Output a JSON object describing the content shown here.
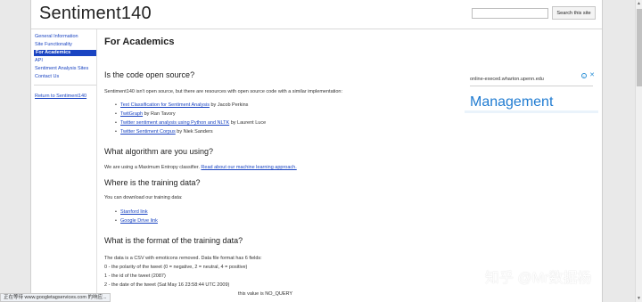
{
  "header": {
    "site_title": "Sentiment140",
    "search_button": "Search this site"
  },
  "sidebar": {
    "items": [
      {
        "label": "General Information"
      },
      {
        "label": "Site Functionality"
      },
      {
        "label": "For Academics"
      },
      {
        "label": "API"
      },
      {
        "label": "Sentiment Analysis Sites"
      },
      {
        "label": "Contact Us"
      }
    ],
    "return_link": "Return to Sentiment140"
  },
  "content": {
    "page_title": "For Academics",
    "q1": {
      "heading": "Is the code open source?",
      "text": "Sentiment140 isn't open source, but there are resources with open source code with a similar implementation:",
      "items": [
        {
          "link": "Text Classification for Sentiment Analysis",
          "suffix": " by Jacob Perkins"
        },
        {
          "link": "TwitGraph",
          "suffix": " by Ran Tavory"
        },
        {
          "link": "Twitter sentiment analysis using Python and NLTK",
          "suffix": " by Laurent Luce"
        },
        {
          "link": "Twitter Sentiment Corpus",
          "suffix": " by Niek Sanders"
        }
      ]
    },
    "q2": {
      "heading": "What algorithm are you using?",
      "text": "We are using a Maximum Entropy classifier.",
      "link": "Read about our machine learning approach."
    },
    "q3": {
      "heading": "Where is the training data?",
      "text": "You can download our training data:",
      "items": [
        "Stanford link",
        "Google Drive link"
      ]
    },
    "q4": {
      "heading": "What is the format of the training data?",
      "lines": [
        "The data is a CSV with emoticons removed. Data file format has 6 fields:",
        "0 - the polarity of the tweet (0 = negative, 2 = neutral, 4 = positive)",
        "1 - the id of the tweet (2087)",
        "2 - the date of the tweet (Sat May 16 23:58:44 UTC 2009)",
        "this value is NO_QUERY"
      ]
    }
  },
  "ad": {
    "url": "online-execed.wharton.upenn.edu",
    "title": "Management",
    "info_icon": "info-icon",
    "close_icon": "close-icon"
  },
  "status_bar": {
    "text": "正在等待 www.googletagservices.com 的响应..."
  },
  "watermark": {
    "text": "知乎 @Mr数据杨"
  },
  "colors": {
    "link": "#1a44c2",
    "active_nav_bg": "#1a44c2",
    "ad_title": "#1f7bd1",
    "page_bg": "#e9e9e9"
  }
}
